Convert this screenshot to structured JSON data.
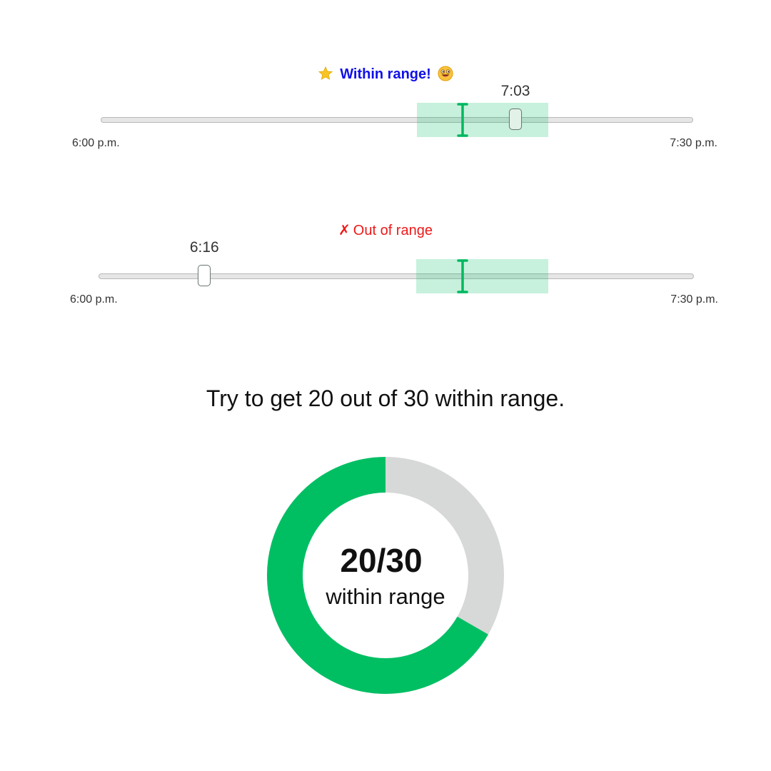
{
  "colors": {
    "within_text": "#1010e8",
    "out_text": "#f01818",
    "target_band": "rgba(0,190,100,0.22)",
    "target_marker": "#00b860",
    "donut_within": "#00bf63",
    "donut_rest": "#d7d8d8"
  },
  "sliders": [
    {
      "status_icons": [
        "star-icon",
        "grinning-face-tongue-icon"
      ],
      "status_text": "Within range!",
      "status": "within",
      "value_label": "7:03",
      "min_label": "6:00 p.m.",
      "max_label": "7:30 p.m.",
      "value_minutes": 63,
      "range_minutes": 90,
      "target_minutes": 55,
      "target_window_minutes": [
        48,
        68
      ]
    },
    {
      "status_icons": [
        "cross-mark-icon"
      ],
      "status_glyph": "✗",
      "status_text": "Out of range",
      "status": "out",
      "value_label": "6:16",
      "min_label": "6:00 p.m.",
      "max_label": "7:30 p.m.",
      "value_minutes": 16,
      "range_minutes": 90,
      "target_minutes": 55,
      "target_window_minutes": [
        48,
        68
      ]
    }
  ],
  "instruction": "Try to get 20 out of 30 within range.",
  "score": {
    "count_label": "20/30",
    "caption": "within range",
    "within": 20,
    "total": 30
  }
}
